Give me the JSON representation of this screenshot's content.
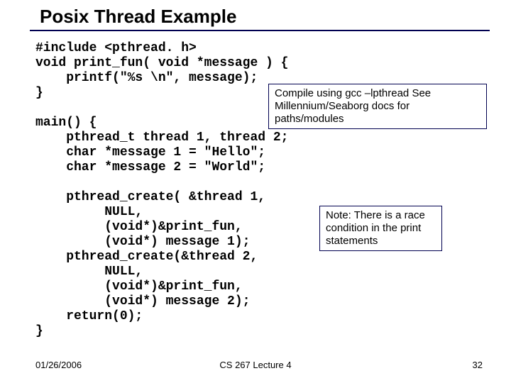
{
  "title": "Posix Thread Example",
  "code": "#include <pthread. h>\nvoid print_fun( void *message ) {\n    printf(\"%s \\n\", message);\n}\n\nmain() {\n    pthread_t thread 1, thread 2;\n    char *message 1 = \"Hello\";\n    char *message 2 = \"World\";\n\n    pthread_create( &thread 1,\n         NULL,\n         (void*)&print_fun,\n         (void*) message 1);\n    pthread_create(&thread 2,\n         NULL,\n         (void*)&print_fun,\n         (void*) message 2);\n    return(0);\n}",
  "note1": "Compile using gcc –lpthread\nSee Millennium/Seaborg docs for paths/modules",
  "note2": "Note: There is a race condition in the print statements",
  "footer": {
    "date": "01/26/2006",
    "center": "CS 267 Lecture 4",
    "page": "32"
  }
}
